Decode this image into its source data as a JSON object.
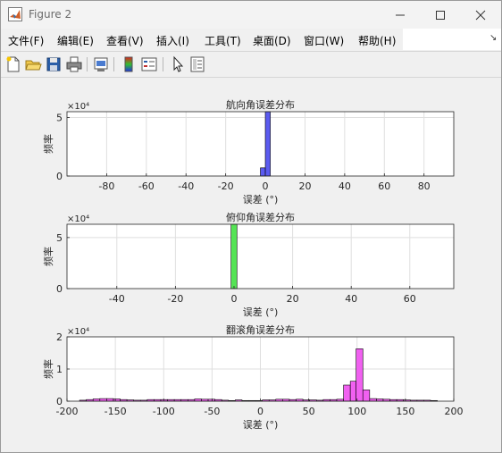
{
  "window": {
    "title": "Figure 2"
  },
  "menu": {
    "items": [
      {
        "label": "文件(F)"
      },
      {
        "label": "编辑(E)"
      },
      {
        "label": "查看(V)"
      },
      {
        "label": "插入(I)"
      },
      {
        "label": "工具(T)"
      },
      {
        "label": "桌面(D)"
      },
      {
        "label": "窗口(W)"
      },
      {
        "label": "帮助(H)"
      }
    ]
  },
  "toolbar": {
    "buttons": [
      {
        "icon": "new-figure-icon"
      },
      {
        "icon": "open-file-icon"
      },
      {
        "icon": "save-icon"
      },
      {
        "icon": "print-icon"
      },
      {
        "icon": "link-plot-icon"
      },
      {
        "icon": "colorbar-icon"
      },
      {
        "icon": "legend-icon"
      },
      {
        "icon": "edit-plot-arrow-icon"
      },
      {
        "icon": "property-inspector-icon"
      }
    ]
  },
  "colors": {
    "yaw": "#5b5bf0",
    "pitch": "#55e455",
    "roll": "#f060f0"
  },
  "chart_data": [
    {
      "type": "bar",
      "title": "航向角误差分布",
      "xlabel": "误差 (°)",
      "ylabel": "频率",
      "exponent_label": "×10⁴",
      "xlim": [
        -100,
        95
      ],
      "ylim": [
        0,
        5.5
      ],
      "xticks": [
        -80,
        -60,
        -40,
        -20,
        0,
        20,
        40,
        60,
        80
      ],
      "yticks": [
        0,
        5
      ],
      "grid": true,
      "bin_width": 2.5,
      "bins": [
        {
          "x0": -2.5,
          "x1": 0,
          "v": 0.7
        },
        {
          "x0": 0,
          "x1": 2.5,
          "v": 5.5
        }
      ]
    },
    {
      "type": "bar",
      "title": "俯仰角误差分布",
      "xlabel": "误差 (°)",
      "ylabel": "频率",
      "exponent_label": "×10⁴",
      "xlim": [
        -57,
        75
      ],
      "ylim": [
        0,
        6.3
      ],
      "xticks": [
        -40,
        -20,
        0,
        20,
        40,
        60
      ],
      "yticks": [
        0,
        5
      ],
      "grid": true,
      "bin_width": 2,
      "bins": [
        {
          "x0": -1,
          "x1": 1,
          "v": 6.3
        }
      ]
    },
    {
      "type": "bar",
      "title": "翻滚角误差分布",
      "xlabel": "误差 (°)",
      "ylabel": "频率",
      "exponent_label": "×10⁴",
      "xlim": [
        -200,
        200
      ],
      "ylim": [
        0,
        2
      ],
      "xticks": [
        -200,
        -150,
        -100,
        -50,
        0,
        50,
        100,
        150,
        200
      ],
      "yticks": [
        0,
        1,
        2
      ],
      "grid": true,
      "bin_width": 7,
      "bins": [
        {
          "x0": -187,
          "x1": -180,
          "v": 0.03
        },
        {
          "x0": -180,
          "x1": -173,
          "v": 0.05
        },
        {
          "x0": -173,
          "x1": -166,
          "v": 0.07
        },
        {
          "x0": -166,
          "x1": -159,
          "v": 0.08
        },
        {
          "x0": -159,
          "x1": -152,
          "v": 0.08
        },
        {
          "x0": -152,
          "x1": -145,
          "v": 0.07
        },
        {
          "x0": -145,
          "x1": -138,
          "v": 0.05
        },
        {
          "x0": -138,
          "x1": -131,
          "v": 0.04
        },
        {
          "x0": -131,
          "x1": -124,
          "v": 0.03
        },
        {
          "x0": -124,
          "x1": -117,
          "v": 0.03
        },
        {
          "x0": -117,
          "x1": -110,
          "v": 0.05
        },
        {
          "x0": -110,
          "x1": -103,
          "v": 0.05
        },
        {
          "x0": -103,
          "x1": -96,
          "v": 0.05
        },
        {
          "x0": -96,
          "x1": -89,
          "v": 0.05
        },
        {
          "x0": -89,
          "x1": -82,
          "v": 0.05
        },
        {
          "x0": -82,
          "x1": -75,
          "v": 0.05
        },
        {
          "x0": -75,
          "x1": -68,
          "v": 0.05
        },
        {
          "x0": -68,
          "x1": -61,
          "v": 0.07
        },
        {
          "x0": -61,
          "x1": -54,
          "v": 0.06
        },
        {
          "x0": -54,
          "x1": -47,
          "v": 0.06
        },
        {
          "x0": -47,
          "x1": -40,
          "v": 0.05
        },
        {
          "x0": -40,
          "x1": -33,
          "v": 0.03
        },
        {
          "x0": -33,
          "x1": -26,
          "v": 0.02
        },
        {
          "x0": -26,
          "x1": -19,
          "v": 0.04
        },
        {
          "x0": -19,
          "x1": -12,
          "v": 0.02
        },
        {
          "x0": -12,
          "x1": -5,
          "v": 0.02
        },
        {
          "x0": -5,
          "x1": 2,
          "v": 0.02
        },
        {
          "x0": 2,
          "x1": 9,
          "v": 0.04
        },
        {
          "x0": 9,
          "x1": 16,
          "v": 0.04
        },
        {
          "x0": 16,
          "x1": 23,
          "v": 0.06
        },
        {
          "x0": 23,
          "x1": 30,
          "v": 0.06
        },
        {
          "x0": 30,
          "x1": 37,
          "v": 0.05
        },
        {
          "x0": 37,
          "x1": 44,
          "v": 0.06
        },
        {
          "x0": 44,
          "x1": 51,
          "v": 0.04
        },
        {
          "x0": 51,
          "x1": 58,
          "v": 0.04
        },
        {
          "x0": 58,
          "x1": 65,
          "v": 0.03
        },
        {
          "x0": 65,
          "x1": 72,
          "v": 0.05
        },
        {
          "x0": 72,
          "x1": 79,
          "v": 0.05
        },
        {
          "x0": 79,
          "x1": 86,
          "v": 0.06
        },
        {
          "x0": 86,
          "x1": 93,
          "v": 0.5
        },
        {
          "x0": 93,
          "x1": 99,
          "v": 0.62
        },
        {
          "x0": 99,
          "x1": 106,
          "v": 1.63
        },
        {
          "x0": 106,
          "x1": 113,
          "v": 0.35
        },
        {
          "x0": 113,
          "x1": 120,
          "v": 0.08
        },
        {
          "x0": 120,
          "x1": 127,
          "v": 0.07
        },
        {
          "x0": 127,
          "x1": 134,
          "v": 0.06
        },
        {
          "x0": 134,
          "x1": 141,
          "v": 0.05
        },
        {
          "x0": 141,
          "x1": 148,
          "v": 0.05
        },
        {
          "x0": 148,
          "x1": 155,
          "v": 0.04
        },
        {
          "x0": 155,
          "x1": 162,
          "v": 0.03
        },
        {
          "x0": 162,
          "x1": 169,
          "v": 0.03
        },
        {
          "x0": 169,
          "x1": 176,
          "v": 0.03
        },
        {
          "x0": 176,
          "x1": 183,
          "v": 0.02
        },
        {
          "x0": 200,
          "x1": 203,
          "v": 0.03
        }
      ]
    }
  ]
}
